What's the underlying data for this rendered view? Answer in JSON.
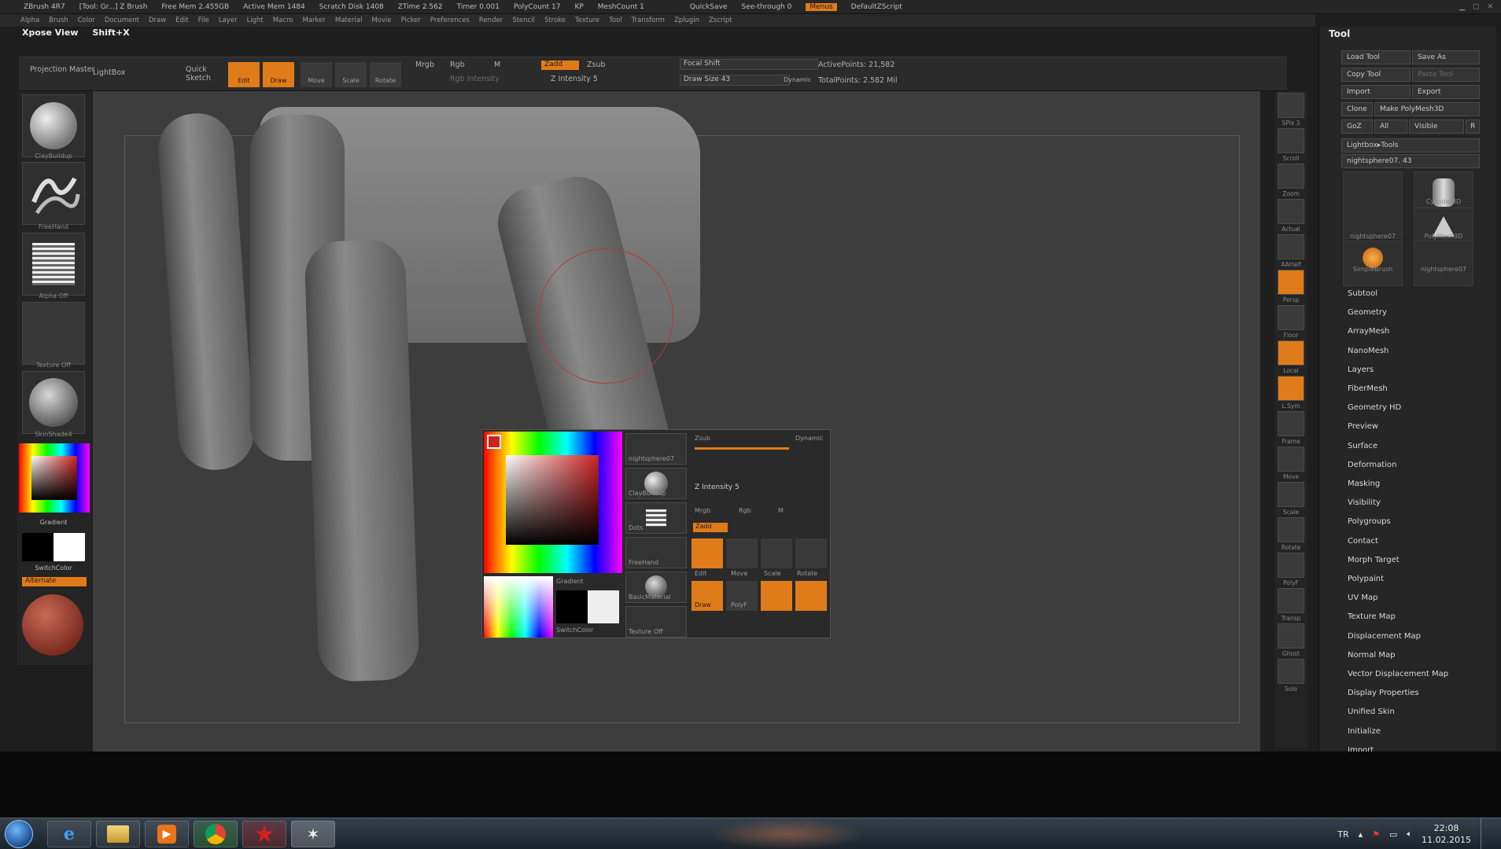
{
  "window": {
    "title_items": [
      "ZBrush 4R7",
      "[Tool: Gr...] Z Brush",
      "Free Mem 2.455GB",
      "Active Mem 1484",
      "Scratch Disk 1408",
      "ZTime 2.562",
      "Timer 0.001",
      "PolyCount 17",
      "KP",
      "MeshCount 1"
    ],
    "quicksave": "QuickSave",
    "see_through": "See-through 0",
    "menus_label": "Menus",
    "default_script": "DefaultZScript"
  },
  "menubar": {
    "items": [
      "Alpha",
      "Brush",
      "Color",
      "Document",
      "Draw",
      "Edit",
      "File",
      "Layer",
      "Light",
      "Macro",
      "Marker",
      "Material",
      "Movie",
      "Picker",
      "Preferences",
      "Render",
      "Stencil",
      "Stroke",
      "Texture",
      "Tool",
      "Transform",
      "Zplugin",
      "Zscript"
    ]
  },
  "hotkey": {
    "label": "Xpose View",
    "shortcut": "Shift+X"
  },
  "shelf": {
    "projection_master": "Projection Master",
    "lightbox": "LightBox",
    "quick_sketch": "Quick Sketch",
    "edit": "Edit",
    "draw": "Draw",
    "move": "Move",
    "scale": "Scale",
    "rotate": "Rotate",
    "mrgb": "Mrgb",
    "rgb": "Rgb",
    "m": "M",
    "zadd": "Zadd",
    "zsub": "Zsub",
    "rgb_intensity": "Rgb Intensity",
    "z_intensity": "Z Intensity 5",
    "focal_shift": "Focal Shift",
    "draw_size": "Draw Size 43",
    "dynamic": "Dynamic",
    "active_points": "ActivePoints: 21,582",
    "total_points": "TotalPoints: 2.582 Mil"
  },
  "lefttray": {
    "clay_buildup": "ClayBuildup",
    "freehand": "FreeHand",
    "alpha_label": "Alpha Off",
    "texture_label": "Texture Off",
    "material_label": "SkinShade4",
    "gradient": "Gradient",
    "switch_color": "SwitchColor",
    "alternate": "Alternate"
  },
  "palette": {
    "nightsphere": "nightsphere07",
    "clay_buildup": "ClayBuildup",
    "dots": "Dots",
    "freehand": "FreeHand",
    "basic_material": "BasicMaterial",
    "texture_off": "Texture Off",
    "gradient": "Gradient",
    "switch_color": "SwitchColor",
    "mrgb": "Mrgb",
    "rgb": "Rgb",
    "m": "M",
    "zadd": "Zadd",
    "zsub": "Zsub",
    "z_intensity": "Z Intensity 5",
    "edit": "Edit",
    "move": "Move",
    "scale": "Scale",
    "rotate": "Rotate",
    "polyf": "PolyF",
    "draw": "Draw",
    "dynamic": "Dynamic"
  },
  "rightshelf": {
    "items": [
      "SPix 3",
      "Scroll",
      "Zoom",
      "Actual",
      "AAHalf",
      "Persp",
      "Floor",
      "Local",
      "L.Sym",
      "Frame",
      "Move",
      "Scale",
      "Rotate",
      "PolyF",
      "Transp",
      "Ghost",
      "Solo"
    ]
  },
  "tool": {
    "title": "Tool",
    "load_tool": "Load Tool",
    "save_as": "Save As",
    "copy_tool": "Copy Tool",
    "paste_tool": "Paste Tool",
    "import": "Import",
    "export": "Export",
    "clone": "Clone",
    "make_polymesh": "Make PolyMesh3D",
    "goz": "GoZ",
    "all": "All",
    "visible": "Visible",
    "r": "R",
    "lightbox_tools": "Lightbox▸Tools",
    "current_tool": "nightsphere07. 43",
    "thumbs": [
      "nightsphere07",
      "Cylinder3D",
      "PolyMesh3D",
      "SimpleBrush",
      "nightsphere07"
    ],
    "subpalettes": [
      "Subtool",
      "Geometry",
      "ArrayMesh",
      "NanoMesh",
      "Layers",
      "FiberMesh",
      "Geometry HD",
      "Preview",
      "Surface",
      "Deformation",
      "Masking",
      "Visibility",
      "Polygroups",
      "Contact",
      "Morph Target",
      "Polypaint",
      "UV Map",
      "Texture Map",
      "Displacement Map",
      "Normal Map",
      "Vector Displacement Map",
      "Display Properties",
      "Unified Skin",
      "Initialize",
      "Import"
    ]
  },
  "taskbar": {
    "language": "TR",
    "time": "22:08",
    "date": "11.02.2015"
  },
  "colors": {
    "accent": "#e07b1a",
    "panel": "#262626",
    "canvas": "#3d3d3d"
  }
}
